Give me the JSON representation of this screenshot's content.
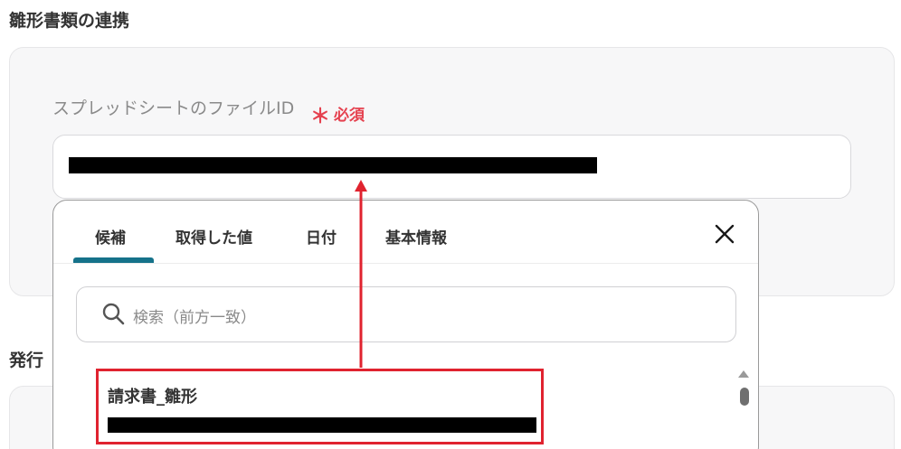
{
  "section_title": "雛形書類の連携",
  "field": {
    "label": "スプレッドシートのファイルID",
    "required_mark": "＊",
    "required_text": "必須"
  },
  "popup": {
    "tabs": [
      {
        "label": "候補",
        "active": true
      },
      {
        "label": "取得した値",
        "active": false
      },
      {
        "label": "日付",
        "active": false
      },
      {
        "label": "基本情報",
        "active": false
      }
    ],
    "close_icon": "close-icon",
    "search_placeholder": "検索（前方一致）",
    "items": [
      {
        "title": "請求書_雛形"
      }
    ]
  },
  "section_title_2_partial": "発行",
  "colors": {
    "accent": "#15728a",
    "required": "#e5414f",
    "highlight": "#e0232f"
  }
}
